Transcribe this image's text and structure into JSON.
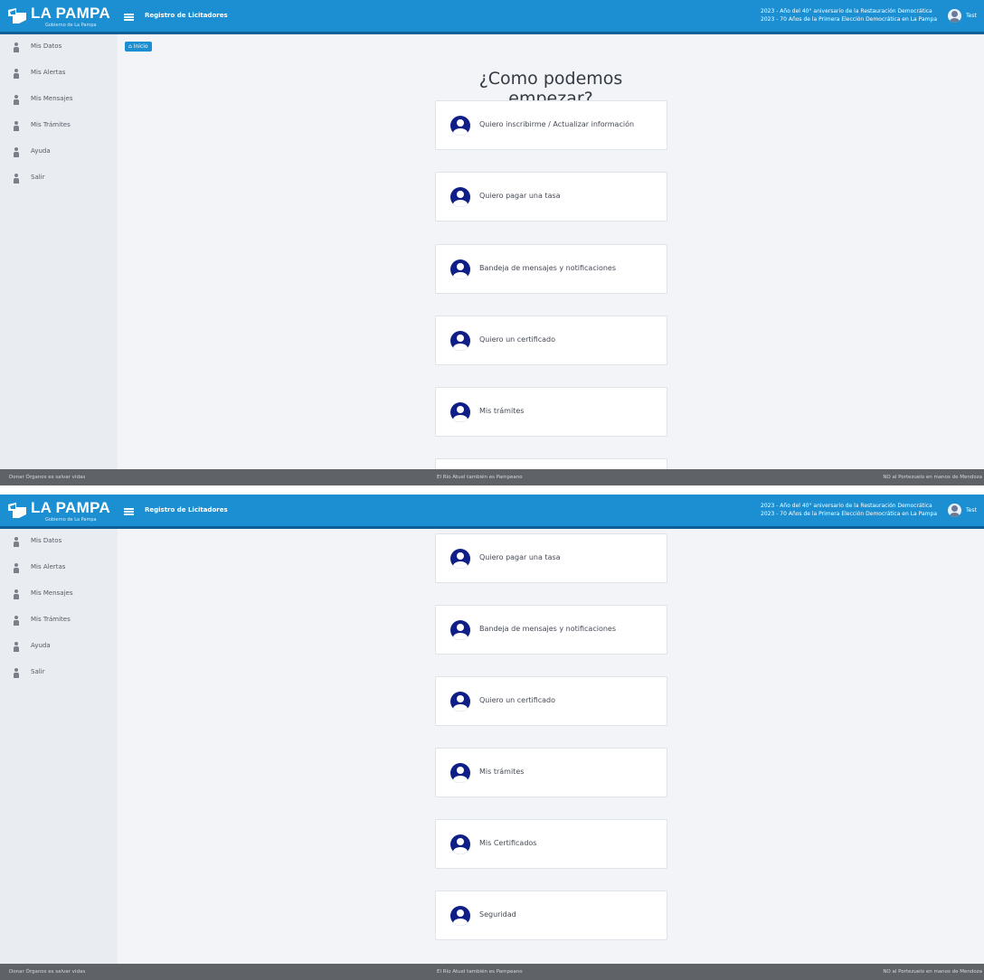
{
  "header": {
    "logo_text": "LA PAMPA",
    "logo_subtitle": "Gobierno de La Pampa",
    "app_title": "Registro de Licitadores",
    "announcement_line1": "2023 - Año del 40° aniversario de la Restauración Democrática",
    "announcement_line2": "2023 - 70 Años de la Primera Elección Democrática en La Pampa",
    "user_name": "Test",
    "brand_color": "#1b8fd1"
  },
  "sidebar": {
    "items": [
      {
        "label": "Mis Datos",
        "icon": "user-icon"
      },
      {
        "label": "Mis Alertas",
        "icon": "user-icon"
      },
      {
        "label": "Mis Mensajes",
        "icon": "user-icon"
      },
      {
        "label": "Mis Trámites",
        "icon": "user-icon"
      },
      {
        "label": "Ayuda",
        "icon": "user-icon"
      },
      {
        "label": "Salir",
        "icon": "user-icon"
      }
    ]
  },
  "breadcrumb": {
    "label": "⌂ Inicio"
  },
  "main": {
    "headline": "¿Como podemos empezar?",
    "cards": [
      {
        "label": "Quiero inscribirme / Actualizar información",
        "icon": "user-circle-icon"
      },
      {
        "label": "Quiero pagar una tasa",
        "icon": "user-circle-icon"
      },
      {
        "label": "Bandeja de mensajes y notificaciones",
        "icon": "user-circle-icon"
      },
      {
        "label": "Quiero un certificado",
        "icon": "user-circle-icon"
      },
      {
        "label": "Mis trámites",
        "icon": "user-circle-icon"
      },
      {
        "label": "Mis Certificados",
        "icon": "user-circle-icon"
      },
      {
        "label": "Seguridad",
        "icon": "user-circle-icon"
      }
    ],
    "card_icon_color": "#0f1f87"
  },
  "footer": {
    "left": "Donar Órganos es salvar vidas",
    "center": "El Río Atuel también es Pampeano",
    "right": "NO al Portezuelo en manos de Mendoza"
  }
}
